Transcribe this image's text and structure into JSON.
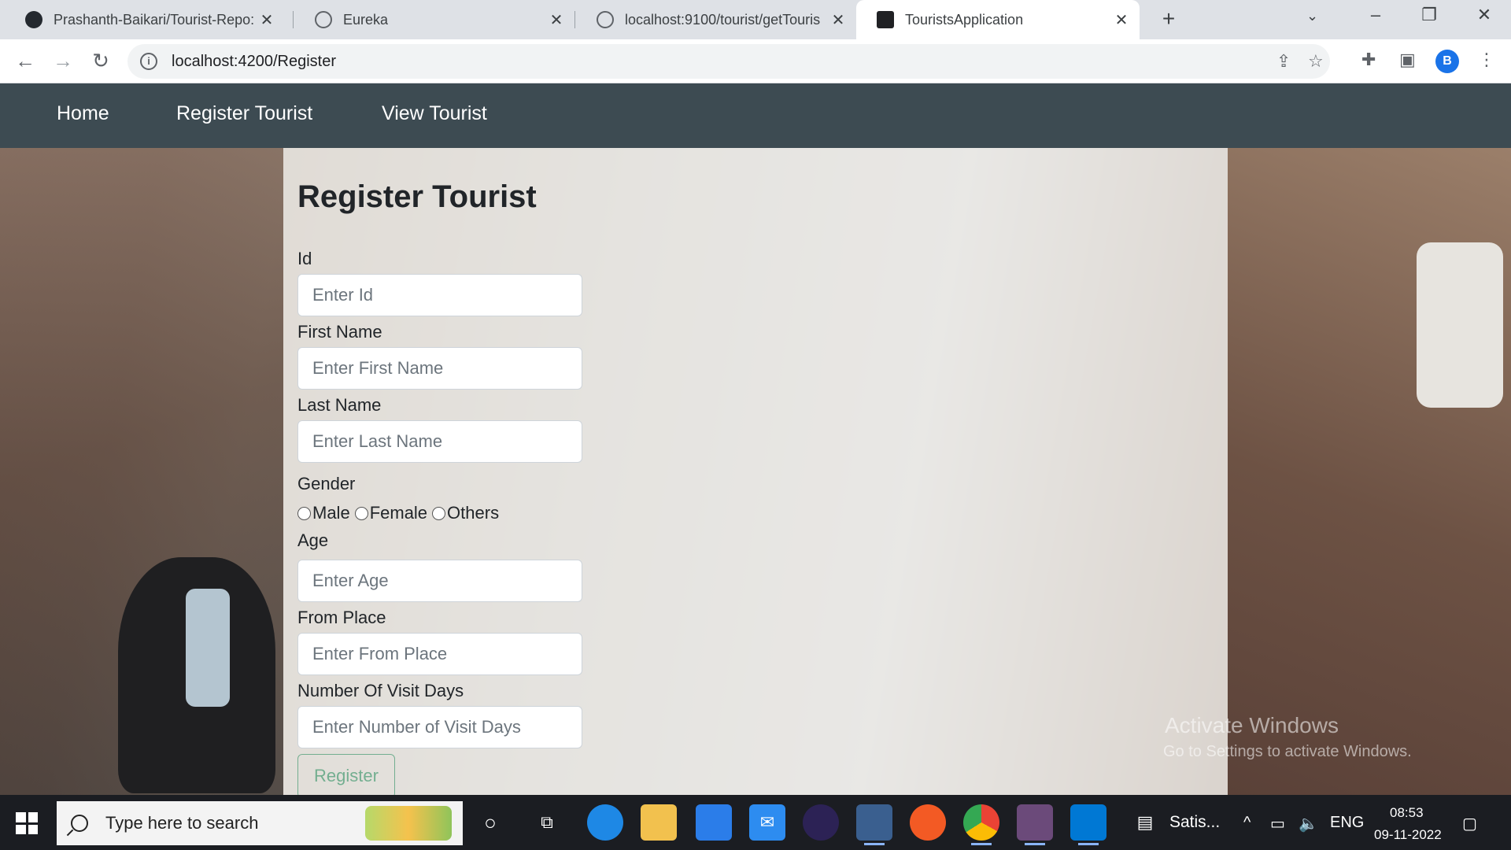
{
  "browser": {
    "tabs": [
      {
        "title": "Prashanth-Baikari/Tourist-Repo: T",
        "icon": "github-icon"
      },
      {
        "title": "Eureka",
        "icon": "globe-icon"
      },
      {
        "title": "localhost:9100/tourist/getTouris",
        "icon": "globe-icon"
      },
      {
        "title": "TouristsApplication",
        "icon": "angular-icon"
      }
    ],
    "url": "localhost:4200/Register",
    "profile_initial": "B"
  },
  "navbar": {
    "links": [
      "Home",
      "Register Tourist",
      "View Tourist"
    ]
  },
  "form": {
    "title": "Register Tourist",
    "fields": [
      {
        "label": "Id",
        "placeholder": "Enter Id"
      },
      {
        "label": "First Name",
        "placeholder": "Enter First Name"
      },
      {
        "label": "Last Name",
        "placeholder": "Enter Last Name"
      },
      {
        "label": "Age",
        "placeholder": "Enter Age"
      },
      {
        "label": "From Place",
        "placeholder": "Enter From Place"
      },
      {
        "label": "Number Of Visit Days",
        "placeholder": "Enter Number of Visit Days"
      }
    ],
    "gender": {
      "label": "Gender",
      "options": [
        "Male",
        "Female",
        "Others"
      ]
    },
    "submit_label": "Register"
  },
  "watermark": {
    "title": "Activate Windows",
    "subtitle": "Go to Settings to activate Windows."
  },
  "taskbar": {
    "search_placeholder": "Type here to search",
    "running_app_label": "Satis...",
    "language": "ENG",
    "time": "08:53",
    "date": "09-11-2022"
  },
  "colors": {
    "navbar": "#3d4b52",
    "register_button": "#198754",
    "taskbar": "#1b1d22"
  }
}
